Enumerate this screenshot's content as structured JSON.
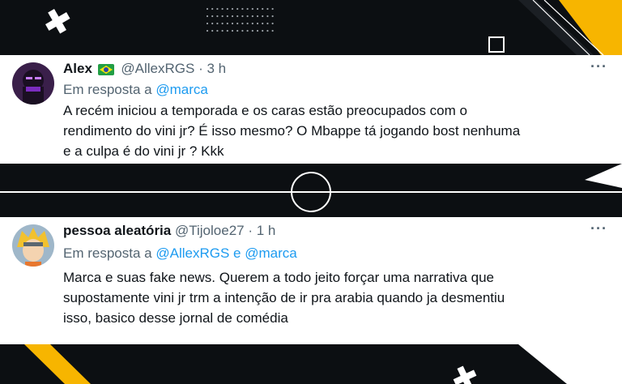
{
  "tweets": [
    {
      "name": "Alex",
      "flag_icon": "brazil-flag-icon",
      "handle": "@AllexRGS",
      "sep": "·",
      "time": "3 h",
      "reply_prefix": "Em resposta a",
      "reply_to": "@marca",
      "text_lines": [
        "A recém iniciou a temporada e os caras estão preocupados com o",
        "rendimento do vini jr? É isso mesmo? O Mbappe tá jogando bost nenhuma",
        "e a culpa é do vini jr ? Kkk"
      ],
      "more_icon": "···"
    },
    {
      "name": "pessoa aleatória",
      "handle": "@Tijoloe27",
      "sep": "·",
      "time": "1 h",
      "reply_prefix": "Em resposta a",
      "reply_to_1": "@AllexRGS",
      "reply_and": "e",
      "reply_to_2": "@marca",
      "text_lines": [
        "Marca e suas fake news. Querem a todo jeito forçar uma narrativa que",
        "supostamente vini jr trm a intenção de ir pra arabia quando ja desmentiu",
        "isso, basico desse jornal de comédia"
      ],
      "more_icon": "···"
    }
  ],
  "colors": {
    "background": "#0c0f12",
    "accent": "#f7b500",
    "link": "#1d9bf0",
    "muted": "#536471",
    "text": "#0f1419"
  }
}
